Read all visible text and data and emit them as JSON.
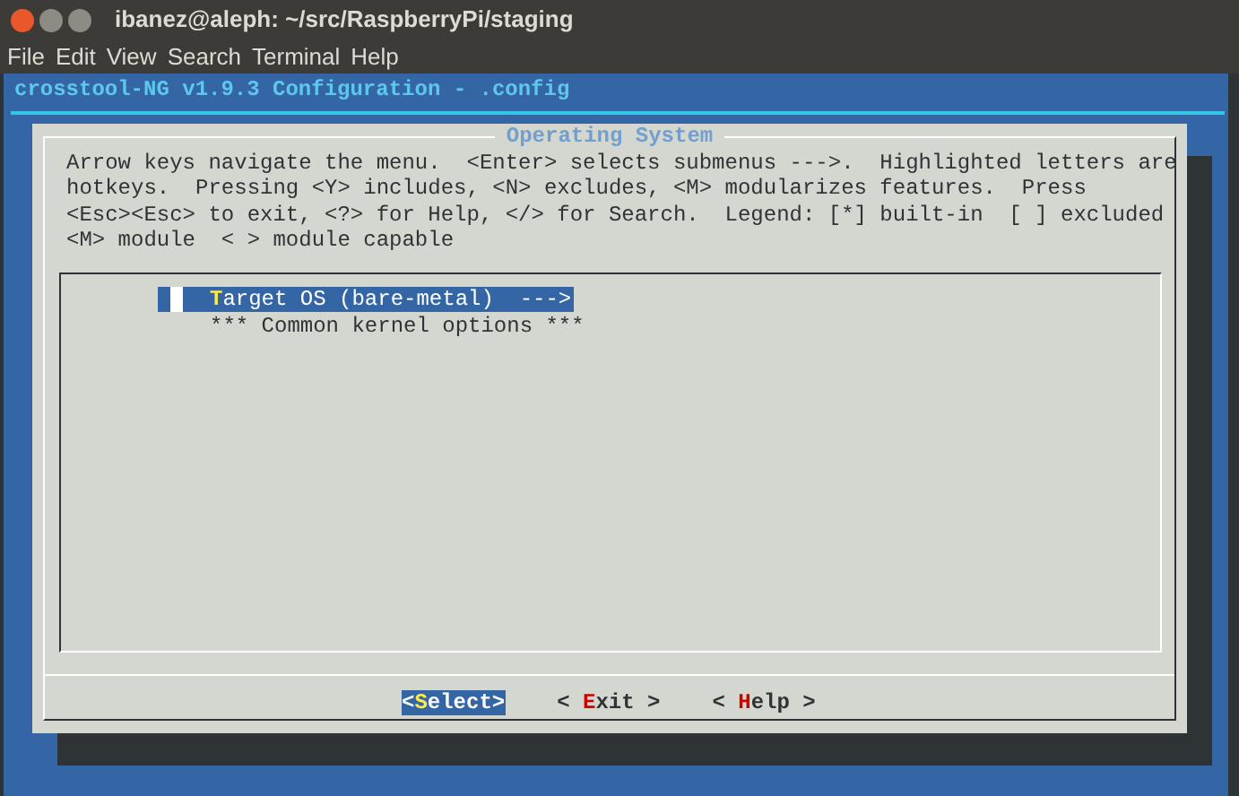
{
  "window": {
    "title": "ibanez@aleph: ~/src/RaspberryPi/staging"
  },
  "menu_bar": [
    "File",
    "Edit",
    "View",
    "Search",
    "Terminal",
    "Help"
  ],
  "terminal": {
    "header": "crosstool-NG v1.9.3 Configuration - .config",
    "dialog": {
      "title": "Operating System",
      "help_lines": [
        "Arrow keys navigate the menu.  <Enter> selects submenus --->.  Highlighted letters are",
        "hotkeys.  Pressing <Y> includes, <N> excludes, <M> modularizes features.  Press",
        "<Esc><Esc> to exit, <?> for Help, </> for Search.  Legend: [*] built-in  [ ] excluded",
        "<M> module  < > module capable"
      ],
      "items": [
        {
          "kind": "submenu",
          "hotkey": "T",
          "after": "arget OS (bare-metal)  --->",
          "selected": true
        },
        {
          "kind": "comment",
          "text": "*** Common kernel options ***",
          "selected": false
        }
      ],
      "buttons": [
        {
          "before": "<",
          "hotkey": "S",
          "after": "elect>",
          "selected": true
        },
        {
          "before": "< ",
          "hotkey": "E",
          "after": "xit >",
          "selected": false
        },
        {
          "before": "< ",
          "hotkey": "H",
          "after": "elp >",
          "selected": false
        }
      ]
    }
  }
}
